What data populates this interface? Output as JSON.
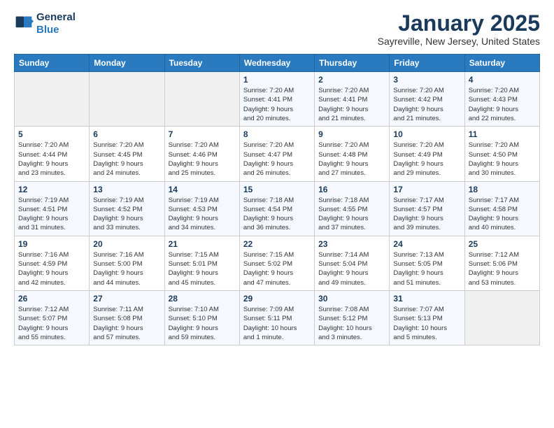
{
  "logo": {
    "line1": "General",
    "line2": "Blue"
  },
  "title": "January 2025",
  "location": "Sayreville, New Jersey, United States",
  "days_of_week": [
    "Sunday",
    "Monday",
    "Tuesday",
    "Wednesday",
    "Thursday",
    "Friday",
    "Saturday"
  ],
  "weeks": [
    [
      {
        "day": "",
        "info": ""
      },
      {
        "day": "",
        "info": ""
      },
      {
        "day": "",
        "info": ""
      },
      {
        "day": "1",
        "info": "Sunrise: 7:20 AM\nSunset: 4:41 PM\nDaylight: 9 hours\nand 20 minutes."
      },
      {
        "day": "2",
        "info": "Sunrise: 7:20 AM\nSunset: 4:41 PM\nDaylight: 9 hours\nand 21 minutes."
      },
      {
        "day": "3",
        "info": "Sunrise: 7:20 AM\nSunset: 4:42 PM\nDaylight: 9 hours\nand 21 minutes."
      },
      {
        "day": "4",
        "info": "Sunrise: 7:20 AM\nSunset: 4:43 PM\nDaylight: 9 hours\nand 22 minutes."
      }
    ],
    [
      {
        "day": "5",
        "info": "Sunrise: 7:20 AM\nSunset: 4:44 PM\nDaylight: 9 hours\nand 23 minutes."
      },
      {
        "day": "6",
        "info": "Sunrise: 7:20 AM\nSunset: 4:45 PM\nDaylight: 9 hours\nand 24 minutes."
      },
      {
        "day": "7",
        "info": "Sunrise: 7:20 AM\nSunset: 4:46 PM\nDaylight: 9 hours\nand 25 minutes."
      },
      {
        "day": "8",
        "info": "Sunrise: 7:20 AM\nSunset: 4:47 PM\nDaylight: 9 hours\nand 26 minutes."
      },
      {
        "day": "9",
        "info": "Sunrise: 7:20 AM\nSunset: 4:48 PM\nDaylight: 9 hours\nand 27 minutes."
      },
      {
        "day": "10",
        "info": "Sunrise: 7:20 AM\nSunset: 4:49 PM\nDaylight: 9 hours\nand 29 minutes."
      },
      {
        "day": "11",
        "info": "Sunrise: 7:20 AM\nSunset: 4:50 PM\nDaylight: 9 hours\nand 30 minutes."
      }
    ],
    [
      {
        "day": "12",
        "info": "Sunrise: 7:19 AM\nSunset: 4:51 PM\nDaylight: 9 hours\nand 31 minutes."
      },
      {
        "day": "13",
        "info": "Sunrise: 7:19 AM\nSunset: 4:52 PM\nDaylight: 9 hours\nand 33 minutes."
      },
      {
        "day": "14",
        "info": "Sunrise: 7:19 AM\nSunset: 4:53 PM\nDaylight: 9 hours\nand 34 minutes."
      },
      {
        "day": "15",
        "info": "Sunrise: 7:18 AM\nSunset: 4:54 PM\nDaylight: 9 hours\nand 36 minutes."
      },
      {
        "day": "16",
        "info": "Sunrise: 7:18 AM\nSunset: 4:55 PM\nDaylight: 9 hours\nand 37 minutes."
      },
      {
        "day": "17",
        "info": "Sunrise: 7:17 AM\nSunset: 4:57 PM\nDaylight: 9 hours\nand 39 minutes."
      },
      {
        "day": "18",
        "info": "Sunrise: 7:17 AM\nSunset: 4:58 PM\nDaylight: 9 hours\nand 40 minutes."
      }
    ],
    [
      {
        "day": "19",
        "info": "Sunrise: 7:16 AM\nSunset: 4:59 PM\nDaylight: 9 hours\nand 42 minutes."
      },
      {
        "day": "20",
        "info": "Sunrise: 7:16 AM\nSunset: 5:00 PM\nDaylight: 9 hours\nand 44 minutes."
      },
      {
        "day": "21",
        "info": "Sunrise: 7:15 AM\nSunset: 5:01 PM\nDaylight: 9 hours\nand 45 minutes."
      },
      {
        "day": "22",
        "info": "Sunrise: 7:15 AM\nSunset: 5:02 PM\nDaylight: 9 hours\nand 47 minutes."
      },
      {
        "day": "23",
        "info": "Sunrise: 7:14 AM\nSunset: 5:04 PM\nDaylight: 9 hours\nand 49 minutes."
      },
      {
        "day": "24",
        "info": "Sunrise: 7:13 AM\nSunset: 5:05 PM\nDaylight: 9 hours\nand 51 minutes."
      },
      {
        "day": "25",
        "info": "Sunrise: 7:12 AM\nSunset: 5:06 PM\nDaylight: 9 hours\nand 53 minutes."
      }
    ],
    [
      {
        "day": "26",
        "info": "Sunrise: 7:12 AM\nSunset: 5:07 PM\nDaylight: 9 hours\nand 55 minutes."
      },
      {
        "day": "27",
        "info": "Sunrise: 7:11 AM\nSunset: 5:08 PM\nDaylight: 9 hours\nand 57 minutes."
      },
      {
        "day": "28",
        "info": "Sunrise: 7:10 AM\nSunset: 5:10 PM\nDaylight: 9 hours\nand 59 minutes."
      },
      {
        "day": "29",
        "info": "Sunrise: 7:09 AM\nSunset: 5:11 PM\nDaylight: 10 hours\nand 1 minute."
      },
      {
        "day": "30",
        "info": "Sunrise: 7:08 AM\nSunset: 5:12 PM\nDaylight: 10 hours\nand 3 minutes."
      },
      {
        "day": "31",
        "info": "Sunrise: 7:07 AM\nSunset: 5:13 PM\nDaylight: 10 hours\nand 5 minutes."
      },
      {
        "day": "",
        "info": ""
      }
    ]
  ]
}
